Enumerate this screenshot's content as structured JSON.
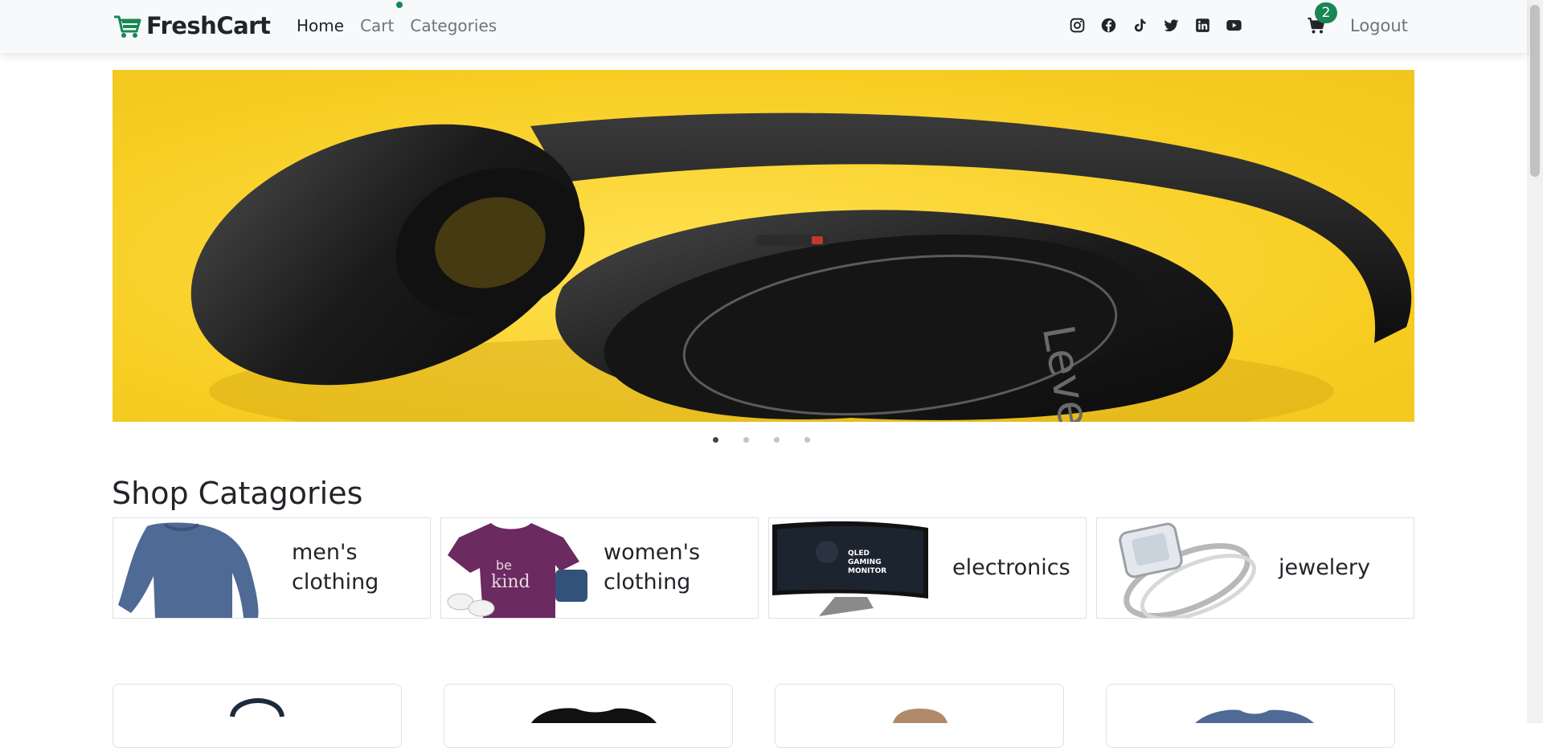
{
  "brand": {
    "name": "FreshCart",
    "accent": "#198754"
  },
  "nav": {
    "links": [
      {
        "label": "Home",
        "active": true
      },
      {
        "label": "Cart",
        "active": false
      },
      {
        "label": "Categories",
        "active": false
      }
    ]
  },
  "social": [
    "instagram-icon",
    "facebook-icon",
    "tiktok-icon",
    "twitter-icon",
    "linkedin-icon",
    "youtube-icon"
  ],
  "cart": {
    "count": "2",
    "icon": "cart-icon"
  },
  "logout_label": "Logout",
  "hero": {
    "slide_count": 4,
    "active_slide": 1,
    "brand_text_on_product": "Level"
  },
  "categories": {
    "title": "Shop Catagories",
    "items": [
      {
        "line1": "men's",
        "line2": "clothing"
      },
      {
        "line1": "women's",
        "line2": "clothing"
      },
      {
        "line1": "electronics",
        "line2": ""
      },
      {
        "line1": "jewelery",
        "line2": ""
      }
    ]
  },
  "colors": {
    "hero_background": "#f5c81b",
    "badge": "#198754"
  }
}
